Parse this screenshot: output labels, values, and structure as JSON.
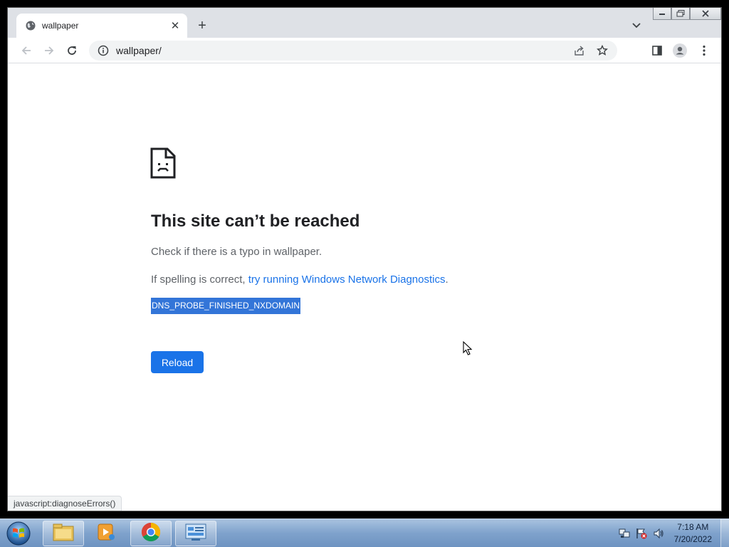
{
  "browser": {
    "tab": {
      "title": "wallpaper",
      "close_glyph": "✕"
    },
    "new_tab_glyph": "+",
    "address": {
      "url": "wallpaper/"
    },
    "icons": {
      "back": "arrow-left-icon",
      "forward": "arrow-right-icon",
      "reload": "reload-icon",
      "site_info": "info-icon",
      "share": "share-icon",
      "bookmark": "star-icon",
      "side_panel": "side-panel-icon",
      "profile": "profile-icon",
      "menu": "kebab-menu-icon"
    }
  },
  "error_page": {
    "title": "This site can’t be reached",
    "line1": "Check if there is a typo in wallpaper.",
    "line2_prefix": "If spelling is correct, ",
    "line2_link": "try running Windows Network Diagnostics",
    "line2_suffix": ".",
    "error_code": "DNS_PROBE_FINISHED_NXDOMAIN",
    "reload_label": "Reload"
  },
  "status_bar": {
    "text": "javascript:diagnoseErrors()"
  },
  "taskbar": {
    "apps": [
      "file-explorer-icon",
      "media-player-icon",
      "chrome-icon",
      "control-panel-icon"
    ],
    "clock": {
      "time": "7:18 AM",
      "date": "7/20/2022"
    }
  },
  "colors": {
    "accent": "#1a73e8",
    "selection": "#3375d8",
    "tabstrip": "#dee1e6"
  }
}
